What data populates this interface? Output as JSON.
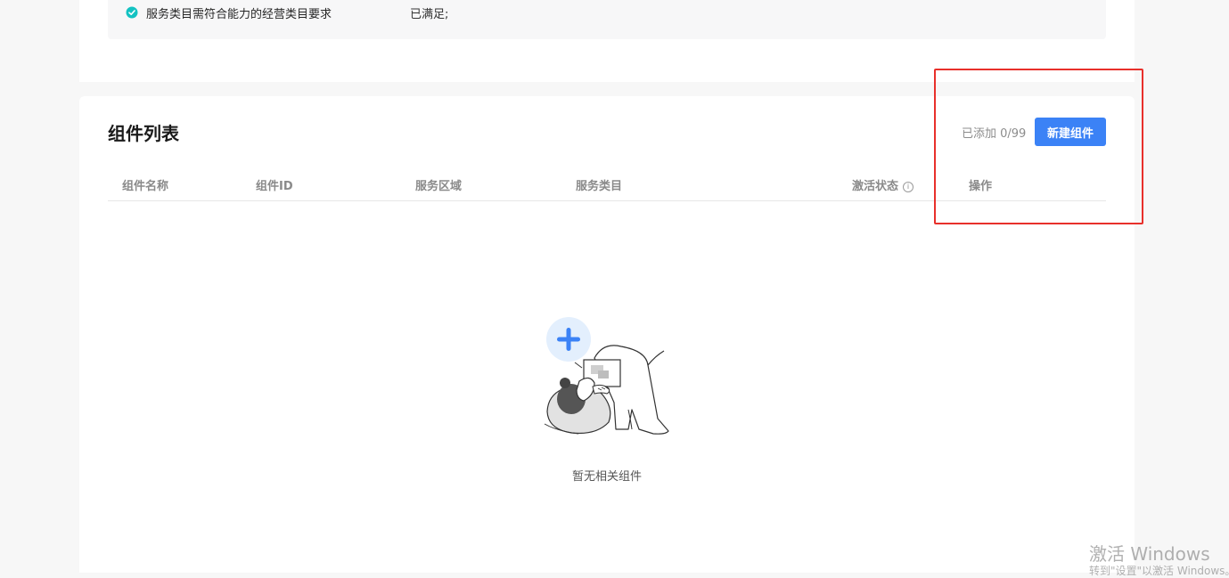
{
  "requirement": {
    "label": "服务类目需符合能力的经营类目要求",
    "status": "已满足;"
  },
  "components": {
    "title": "组件列表",
    "added_count": "已添加 0/99",
    "new_button_label": "新建组件",
    "columns": [
      "组件名称",
      "组件ID",
      "服务区域",
      "服务类目",
      "激活状态",
      "操作"
    ],
    "empty_text": "暂无相关组件"
  },
  "watermark": {
    "title": "激活 Windows",
    "subtitle": "转到\"设置\"以激活 Windows。"
  },
  "colors": {
    "accent": "#3b82f6",
    "check": "#13c2c2",
    "highlight": "#e8302b"
  }
}
